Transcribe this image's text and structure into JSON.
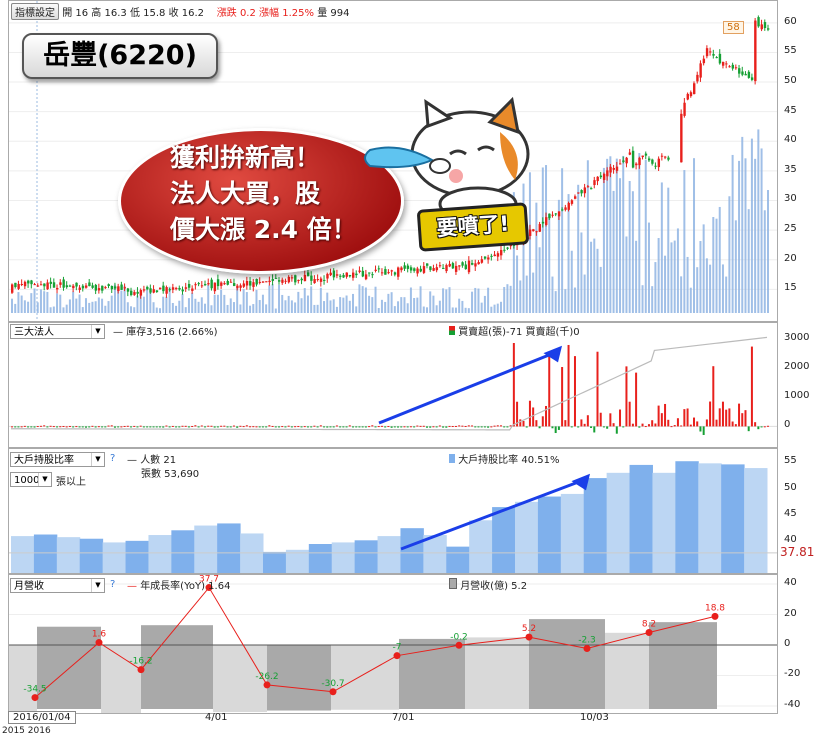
{
  "header": {
    "settings_button": "指標設定",
    "open_label": "開",
    "open": "16",
    "high_label": "高",
    "high": "16.3",
    "low_label": "低",
    "low": "15.8",
    "close_label": "收",
    "close": "16.2",
    "change_label": "漲跌",
    "change": "0.2",
    "pct_label": "漲幅",
    "pct": "1.25%",
    "vol_label": "量",
    "vol": "994"
  },
  "overlay": {
    "stock": "岳豐(6220)",
    "line1": "獲利拚新高！",
    "line2": "法人大買，股",
    "line3": "價大漲 2.4 倍！",
    "sticker": "要噴了!",
    "peak_label": "58"
  },
  "institutional": {
    "select": "三大法人",
    "inventory": "庫存3,516 (2.66%)",
    "buysell": "買賣超(張)-71 買賣超(千)0"
  },
  "holders": {
    "select": "大戶持股比率",
    "threshold": "1000",
    "threshold_unit": "張以上",
    "persons": "人數 21",
    "shares": "張數 53,690",
    "ratio": "大戶持股比率 40.51%",
    "current_value": "37.81"
  },
  "revenue": {
    "select": "月營收",
    "yoy": "年成長率(YoY) 1.64",
    "monthly": "月營收(億) 5.2"
  },
  "x_axis": {
    "start": "2016/01/04",
    "years": "2015  2016"
  },
  "colors": {
    "up": "#e8201c",
    "down": "#16a034",
    "volume": "#8fb4e3",
    "holders_light": "#bcd6f3",
    "holders_dark": "#7fb0ec",
    "rev_light": "#d9d9d9",
    "rev_dark": "#a9a9a9",
    "arrow": "#1a3ee8"
  },
  "chart_data": [
    {
      "type": "candlestick",
      "ylim": [
        11,
        62
      ],
      "yticks": [
        15,
        20,
        25,
        30,
        35,
        40,
        45,
        50,
        55,
        60
      ],
      "xticks": [
        "4/01",
        "7/01",
        "10/03"
      ],
      "last": {
        "open": 16,
        "high": 16.3,
        "low": 15.8,
        "close": 16.2
      },
      "peak": 58
    },
    {
      "type": "bar",
      "ylim": [
        -500,
        3200
      ],
      "yticks": [
        0,
        1000,
        2000,
        3000
      ]
    },
    {
      "type": "area",
      "ylim": [
        34,
        56
      ],
      "yticks": [
        40,
        45,
        50,
        55
      ],
      "last": 37.81
    },
    {
      "type": "bar+line",
      "ylim": [
        -42,
        42
      ],
      "yticks": [
        -40,
        -20,
        0,
        20,
        40
      ],
      "series": [
        {
          "name": "年成長率(YoY)",
          "values": [
            -34.5,
            1.6,
            -16.2,
            37.7,
            -26.2,
            -30.7,
            -7,
            -0.2,
            5.2,
            -2.3,
            8.2,
            18.8
          ]
        }
      ]
    }
  ]
}
